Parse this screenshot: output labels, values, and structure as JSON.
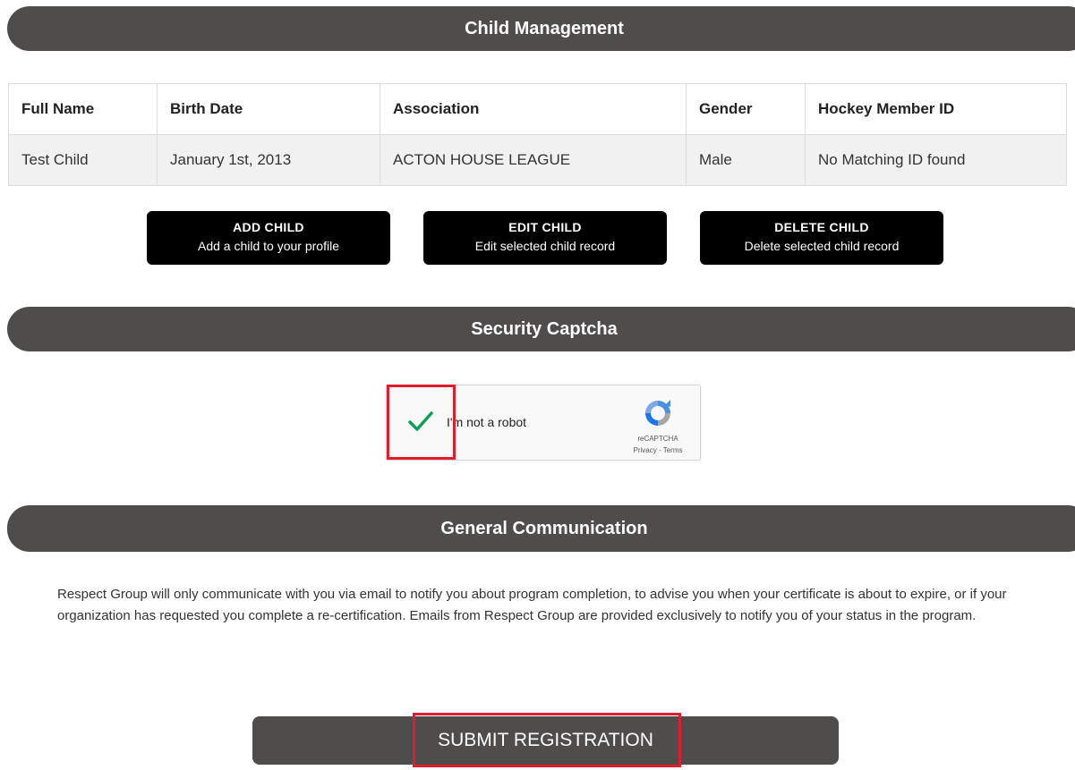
{
  "sections": {
    "child_management": "Child Management",
    "security_captcha": "Security Captcha",
    "general_communication": "General Communication"
  },
  "table": {
    "headers": [
      "Full Name",
      "Birth Date",
      "Association",
      "Gender",
      "Hockey Member ID"
    ],
    "rows": [
      [
        "Test Child",
        "January 1st, 2013",
        "ACTON HOUSE LEAGUE",
        "Male",
        "No Matching ID found"
      ]
    ]
  },
  "actions": {
    "add": {
      "title": "ADD CHILD",
      "subtitle": "Add a child to your profile"
    },
    "edit": {
      "title": "EDIT CHILD",
      "subtitle": "Edit selected child record"
    },
    "delete": {
      "title": "DELETE CHILD",
      "subtitle": "Delete selected child record"
    }
  },
  "captcha": {
    "label": "I'm not a robot",
    "checked": true,
    "brand": "reCAPTCHA",
    "links": "Privacy - Terms"
  },
  "communication": {
    "text": "Respect Group will only communicate with you via email to notify you about program completion, to advise you when your certificate is about to expire, or if your organization has requested you complete a re-certification. Emails from Respect Group are provided exclusively to notify you of your status in the program."
  },
  "submit": {
    "label": "SUBMIT REGISTRATION"
  },
  "colors": {
    "header_bg": "#4f4c4c",
    "button_bg": "#000000",
    "highlight": "#e11d2b",
    "check_green": "#0f9d58"
  },
  "icons": {
    "checkmark": "check-icon",
    "recaptcha_logo": "recaptcha-logo-icon"
  }
}
